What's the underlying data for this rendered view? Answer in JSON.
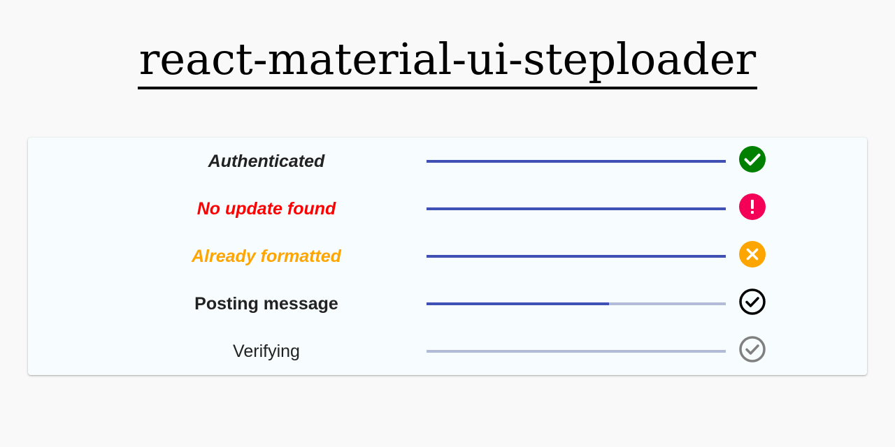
{
  "page": {
    "title": "react-material-ui-steploader"
  },
  "colors": {
    "progress_fill": "#3f51b5",
    "progress_track": "#b2bcd8",
    "success": "#008000",
    "error": "#f50057",
    "warning": "#ffa500",
    "text_dark": "#222222",
    "text_error": "#ff0000",
    "text_warning": "#ffa500"
  },
  "steps": [
    {
      "label": "Authenticated",
      "status": "success",
      "progress": 1.0,
      "icon": "check-circle-filled-icon",
      "text_color": "#222222",
      "italic": true,
      "bold": true
    },
    {
      "label": "No update found",
      "status": "error",
      "progress": 1.0,
      "icon": "exclamation-circle-filled-icon",
      "text_color": "#ff0000",
      "italic": true,
      "bold": true
    },
    {
      "label": "Already formatted",
      "status": "warning",
      "progress": 1.0,
      "icon": "x-circle-filled-icon",
      "text_color": "#ffa500",
      "italic": true,
      "bold": true
    },
    {
      "label": "Posting message",
      "status": "in-progress",
      "progress": 0.61,
      "icon": "check-circle-outline-icon",
      "text_color": "#222222",
      "italic": false,
      "bold": true
    },
    {
      "label": "Verifying",
      "status": "pending",
      "progress": 0.0,
      "icon": "check-circle-outline-gray-icon",
      "text_color": "#222222",
      "italic": false,
      "bold": false
    }
  ]
}
